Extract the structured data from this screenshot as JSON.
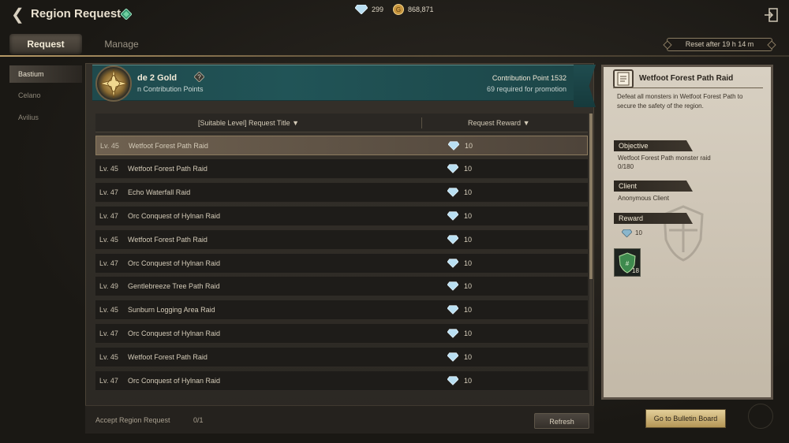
{
  "header": {
    "title": "Region Request",
    "diamonds": "299",
    "gold": "868,871"
  },
  "tabs": {
    "request": "Request",
    "manage": "Manage"
  },
  "reset_timer": "Reset after 19 h 14 m",
  "sidebar": {
    "items": [
      {
        "label": "Bastium"
      },
      {
        "label": "Celano"
      },
      {
        "label": "Avilius"
      }
    ]
  },
  "banner": {
    "grade": "de 2 Gold",
    "grade_sub": "n Contribution Points",
    "contribution": "Contribution Point 1532",
    "promotion": "69 required for promotion"
  },
  "table": {
    "col_title": "[Suitable Level] Request Title",
    "col_reward": "Request Reward",
    "rows": [
      {
        "level": "Lv. 45",
        "title": "Wetfoot Forest Path Raid",
        "reward": "10"
      },
      {
        "level": "Lv. 45",
        "title": "Wetfoot Forest Path Raid",
        "reward": "10"
      },
      {
        "level": "Lv. 47",
        "title": "Echo Waterfall Raid",
        "reward": "10"
      },
      {
        "level": "Lv. 47",
        "title": "Orc Conquest of Hylnan Raid",
        "reward": "10"
      },
      {
        "level": "Lv. 45",
        "title": "Wetfoot Forest Path Raid",
        "reward": "10"
      },
      {
        "level": "Lv. 47",
        "title": "Orc Conquest of Hylnan Raid",
        "reward": "10"
      },
      {
        "level": "Lv. 49",
        "title": "Gentlebreeze Tree Path Raid",
        "reward": "10"
      },
      {
        "level": "Lv. 45",
        "title": "Sunburn Logging Area Raid",
        "reward": "10"
      },
      {
        "level": "Lv. 47",
        "title": "Orc Conquest of Hylnan Raid",
        "reward": "10"
      },
      {
        "level": "Lv. 45",
        "title": "Wetfoot Forest Path Raid",
        "reward": "10"
      },
      {
        "level": "Lv. 47",
        "title": "Orc Conquest of Hylnan Raid",
        "reward": "10"
      }
    ]
  },
  "footer": {
    "accept_label": "Accept Region Request",
    "accept_value": "0/1",
    "refresh": "Refresh"
  },
  "detail": {
    "title": "Wetfoot Forest Path Raid",
    "description": "Defeat all monsters in Wetfoot Forest Path to secure the safety of the region.",
    "objective_head": "Objective",
    "objective": "Wetfoot Forest Path monster raid",
    "objective_progress": "0/180",
    "client_head": "Client",
    "client": "Anonymous Client",
    "reward_head": "Reward",
    "reward_value": "10",
    "item_qty": "18"
  },
  "bulletin_button": "Go to Bulletin Board",
  "colors": {
    "accent_gold": "#b79a67",
    "banner_teal": "#215457",
    "parchment": "#d8d0c2"
  }
}
